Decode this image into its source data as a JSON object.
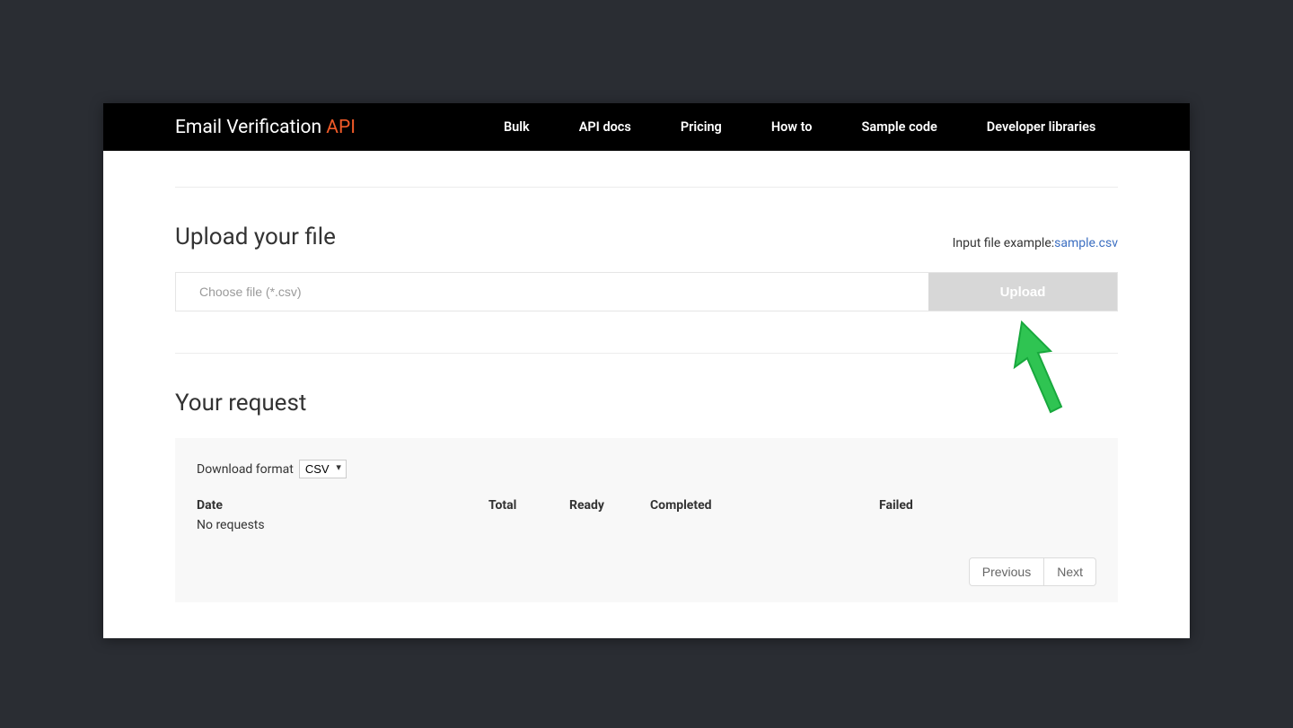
{
  "brand": {
    "main": "Email Verification ",
    "accent": "API"
  },
  "nav": {
    "bulk": "Bulk",
    "api_docs": "API docs",
    "pricing": "Pricing",
    "how_to": "How to",
    "sample_code": "Sample code",
    "dev_libs": "Developer libraries"
  },
  "upload": {
    "heading": "Upload your file",
    "example_label": "Input file example:",
    "example_link": "sample.csv",
    "placeholder": "Choose file (*.csv)",
    "button": "Upload"
  },
  "request": {
    "heading": "Your request",
    "download_label": "Download format",
    "download_selected": "CSV",
    "columns": {
      "date": "Date",
      "total": "Total",
      "ready": "Ready",
      "completed": "Completed",
      "failed": "Failed"
    },
    "empty": "No requests",
    "prev": "Previous",
    "next": "Next"
  }
}
